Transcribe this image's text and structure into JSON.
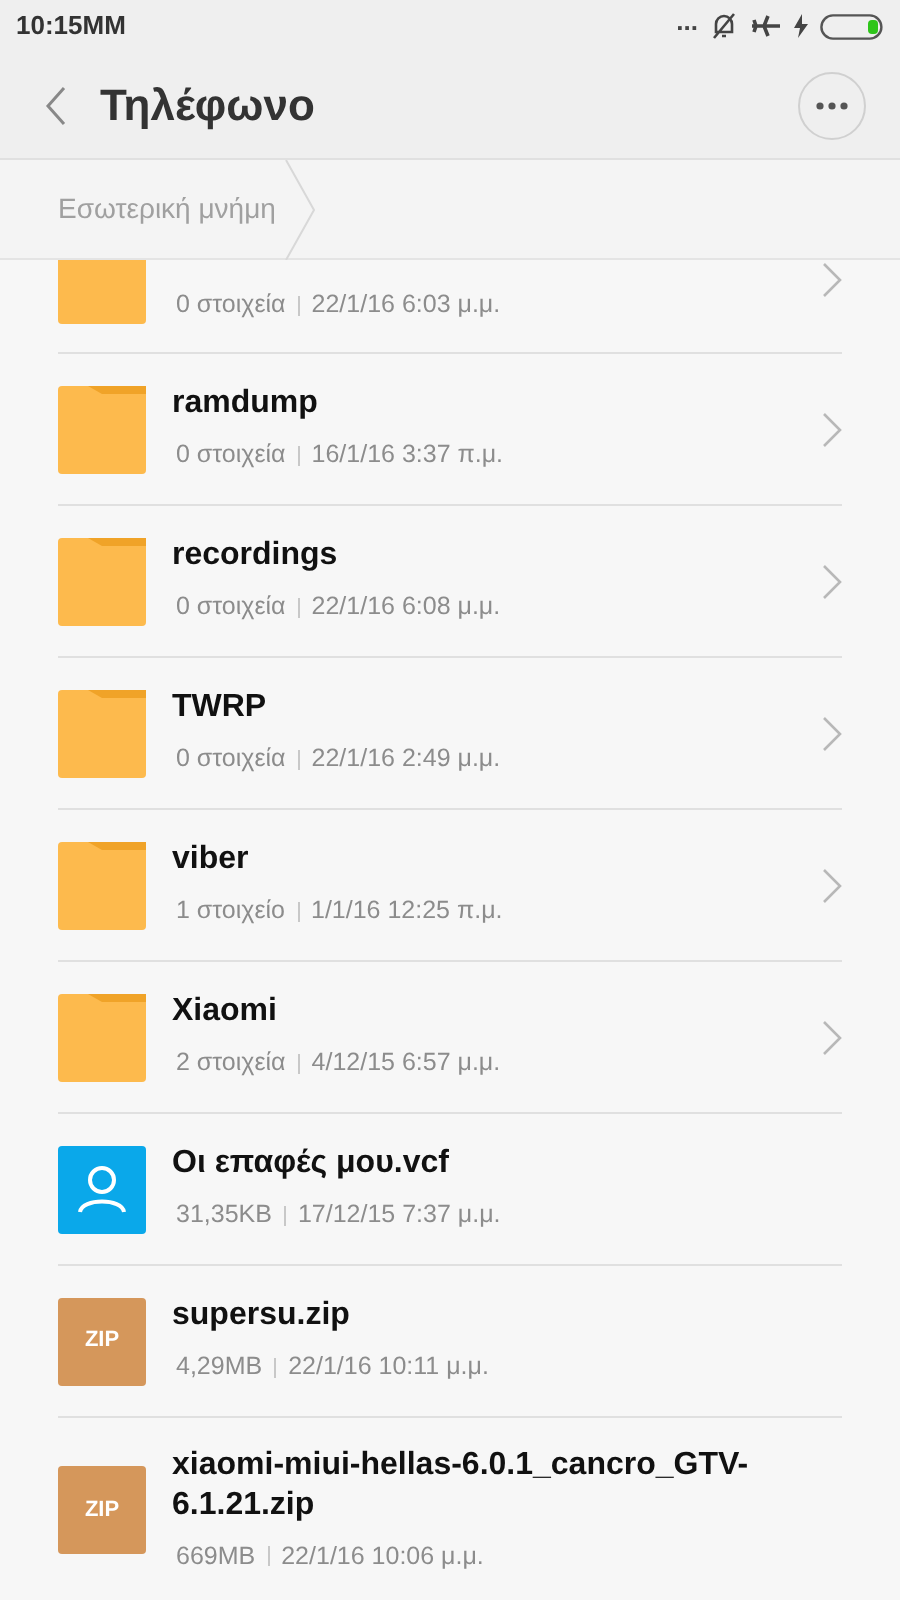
{
  "status_bar": {
    "time": "10:15MM",
    "dots": "..."
  },
  "header": {
    "title": "Τηλέφωνο"
  },
  "breadcrumb": {
    "items": [
      "Εσωτερική μνήμη"
    ]
  },
  "files": [
    {
      "kind": "folder",
      "partial": true,
      "count": "0 στοιχεία",
      "date": "22/1/16 6:03 μ.μ."
    },
    {
      "kind": "folder",
      "partial": false,
      "name": "ramdump",
      "count": "0 στοιχεία",
      "date": "16/1/16 3:37 π.μ."
    },
    {
      "kind": "folder",
      "partial": false,
      "name": "recordings",
      "count": "0 στοιχεία",
      "date": "22/1/16 6:08 μ.μ."
    },
    {
      "kind": "folder",
      "partial": false,
      "name": "TWRP",
      "count": "0 στοιχεία",
      "date": "22/1/16 2:49 μ.μ."
    },
    {
      "kind": "folder",
      "partial": false,
      "name": "viber",
      "count": "1 στοιχείο",
      "date": "1/1/16 12:25 π.μ."
    },
    {
      "kind": "folder",
      "partial": false,
      "name": "Xiaomi",
      "count": "2 στοιχεία",
      "date": "4/12/15 6:57 μ.μ."
    },
    {
      "kind": "contact",
      "partial": false,
      "name": "Οι επαφές μου.vcf",
      "count": "31,35KB",
      "date": "17/12/15 7:37 μ.μ."
    },
    {
      "kind": "zip",
      "partial": false,
      "name": "supersu.zip",
      "icon_label": "ZIP",
      "count": "4,29MB",
      "date": "22/1/16 10:11 μ.μ."
    },
    {
      "kind": "zip",
      "partial": false,
      "name": "xiaomi-miui-hellas-6.0.1_cancro_GTV-6.1.21.zip",
      "icon_label": "ZIP",
      "count": "669MB",
      "date": "22/1/16 10:06 μ.μ."
    }
  ]
}
